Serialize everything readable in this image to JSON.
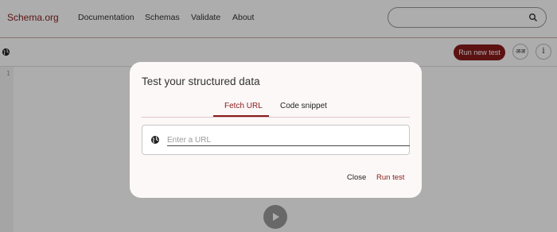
{
  "nav": {
    "logo": "Schema.org",
    "links": [
      "Documentation",
      "Schemas",
      "Validate",
      "About"
    ],
    "search_placeholder": ""
  },
  "toolbar": {
    "run_new_test": "Run new test",
    "lang_button": "अअ",
    "info_button": "i"
  },
  "editor": {
    "line_numbers": [
      "1"
    ]
  },
  "modal": {
    "title": "Test your structured data",
    "tabs": [
      {
        "label": "Fetch URL",
        "active": true
      },
      {
        "label": "Code snippet",
        "active": false
      }
    ],
    "url_placeholder": "Enter a URL",
    "url_value": "",
    "close_label": "Close",
    "run_label": "Run test"
  },
  "colors": {
    "accent": "#8a1b1b"
  }
}
